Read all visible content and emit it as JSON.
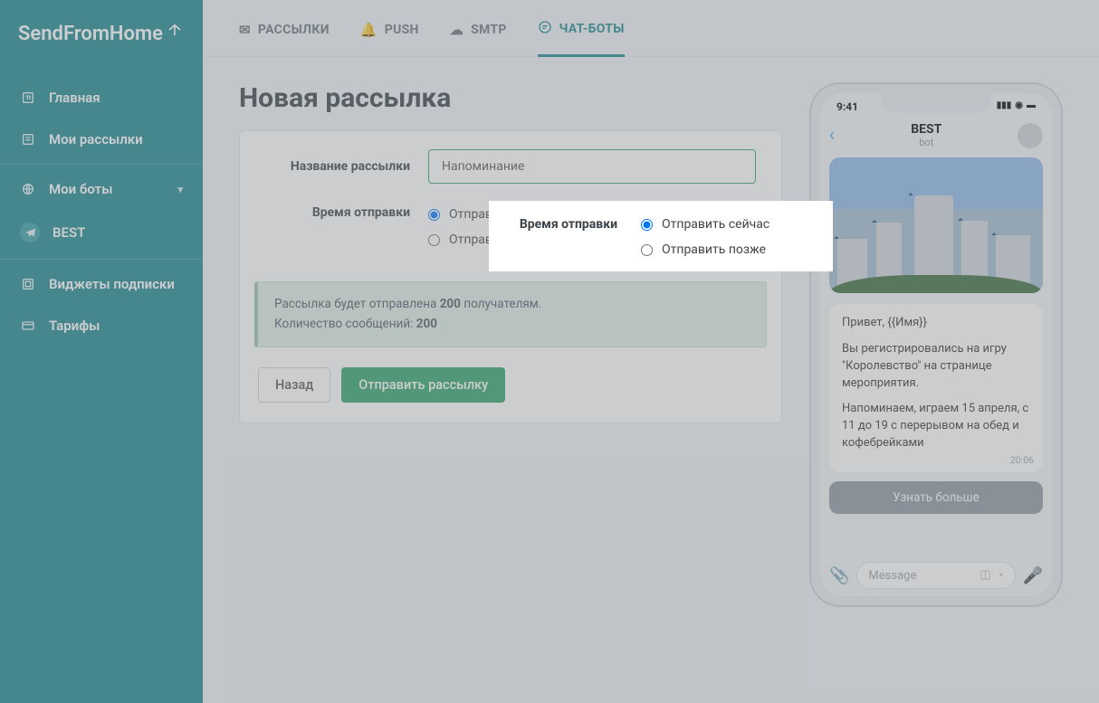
{
  "brand": "SendFromHome",
  "sidebar": {
    "items": [
      {
        "icon": "home",
        "label": "Главная"
      },
      {
        "icon": "list",
        "label": "Мои рассылки"
      },
      {
        "icon": "globe",
        "label": "Мои боты",
        "expandable": true
      },
      {
        "icon": "telegram",
        "label": "BEST",
        "sub": true
      },
      {
        "icon": "widget",
        "label": "Виджеты подписки"
      },
      {
        "icon": "card",
        "label": "Тарифы"
      }
    ]
  },
  "tabs": [
    {
      "icon": "mail",
      "label": "РАССЫЛКИ"
    },
    {
      "icon": "bell",
      "label": "PUSH"
    },
    {
      "icon": "cloud",
      "label": "SMTP"
    },
    {
      "icon": "chat",
      "label": "ЧАТ-БОТЫ",
      "active": true
    }
  ],
  "page": {
    "title": "Новая рассылка",
    "name_label": "Название рассылки",
    "name_value": "Напоминание",
    "time_label": "Время отправки",
    "radio_now": "Отправить сейчас",
    "radio_later": "Отправить позже",
    "info_line1_pre": "Рассылка будет отправлена ",
    "info_line1_count": "200",
    "info_line1_post": " получателям.",
    "info_line2_pre": "Количество сообщений: ",
    "info_line2_count": "200",
    "back_btn": "Назад",
    "send_btn": "Отправить рассылку"
  },
  "preview": {
    "time": "9:41",
    "bot_name": "BEST",
    "bot_sub": "bot",
    "msg_p1": "Привет, {{Имя}}",
    "msg_p2": "Вы регистрировались на игру \"Королевство\" на странице мероприятия.",
    "msg_p3": "Напоминаем, играем 15 апреля, с 11 до 19 с перерывом на обед и кофебрейками",
    "msg_time": "20:06",
    "inline_btn": "Узнать больше",
    "placeholder": "Message"
  }
}
